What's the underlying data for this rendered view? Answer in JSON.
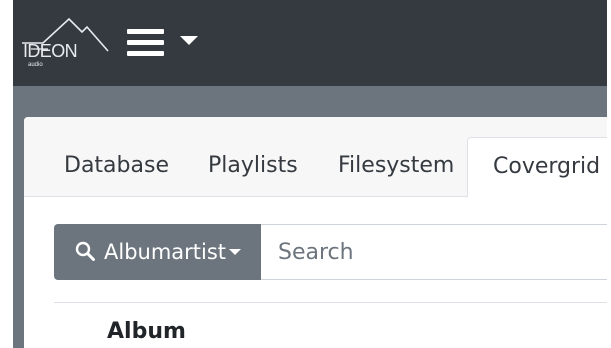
{
  "header": {
    "logo_text": "IDEON",
    "logo_subtext": "audio",
    "menu_icon": "hamburger-icon",
    "menu_caret_icon": "caret-down-icon",
    "colors": {
      "navbar": "#343a40",
      "content": "#6c757d",
      "card_header": "#f7f7f7"
    }
  },
  "tabs": {
    "items": [
      {
        "label": "Database"
      },
      {
        "label": "Playlists"
      },
      {
        "label": "Filesystem"
      },
      {
        "label": "Covergrid",
        "active": true
      }
    ]
  },
  "search": {
    "type_label": "Albumartist",
    "type_icon": "search-icon",
    "placeholder": "Search"
  },
  "table": {
    "header_album": "Album"
  }
}
